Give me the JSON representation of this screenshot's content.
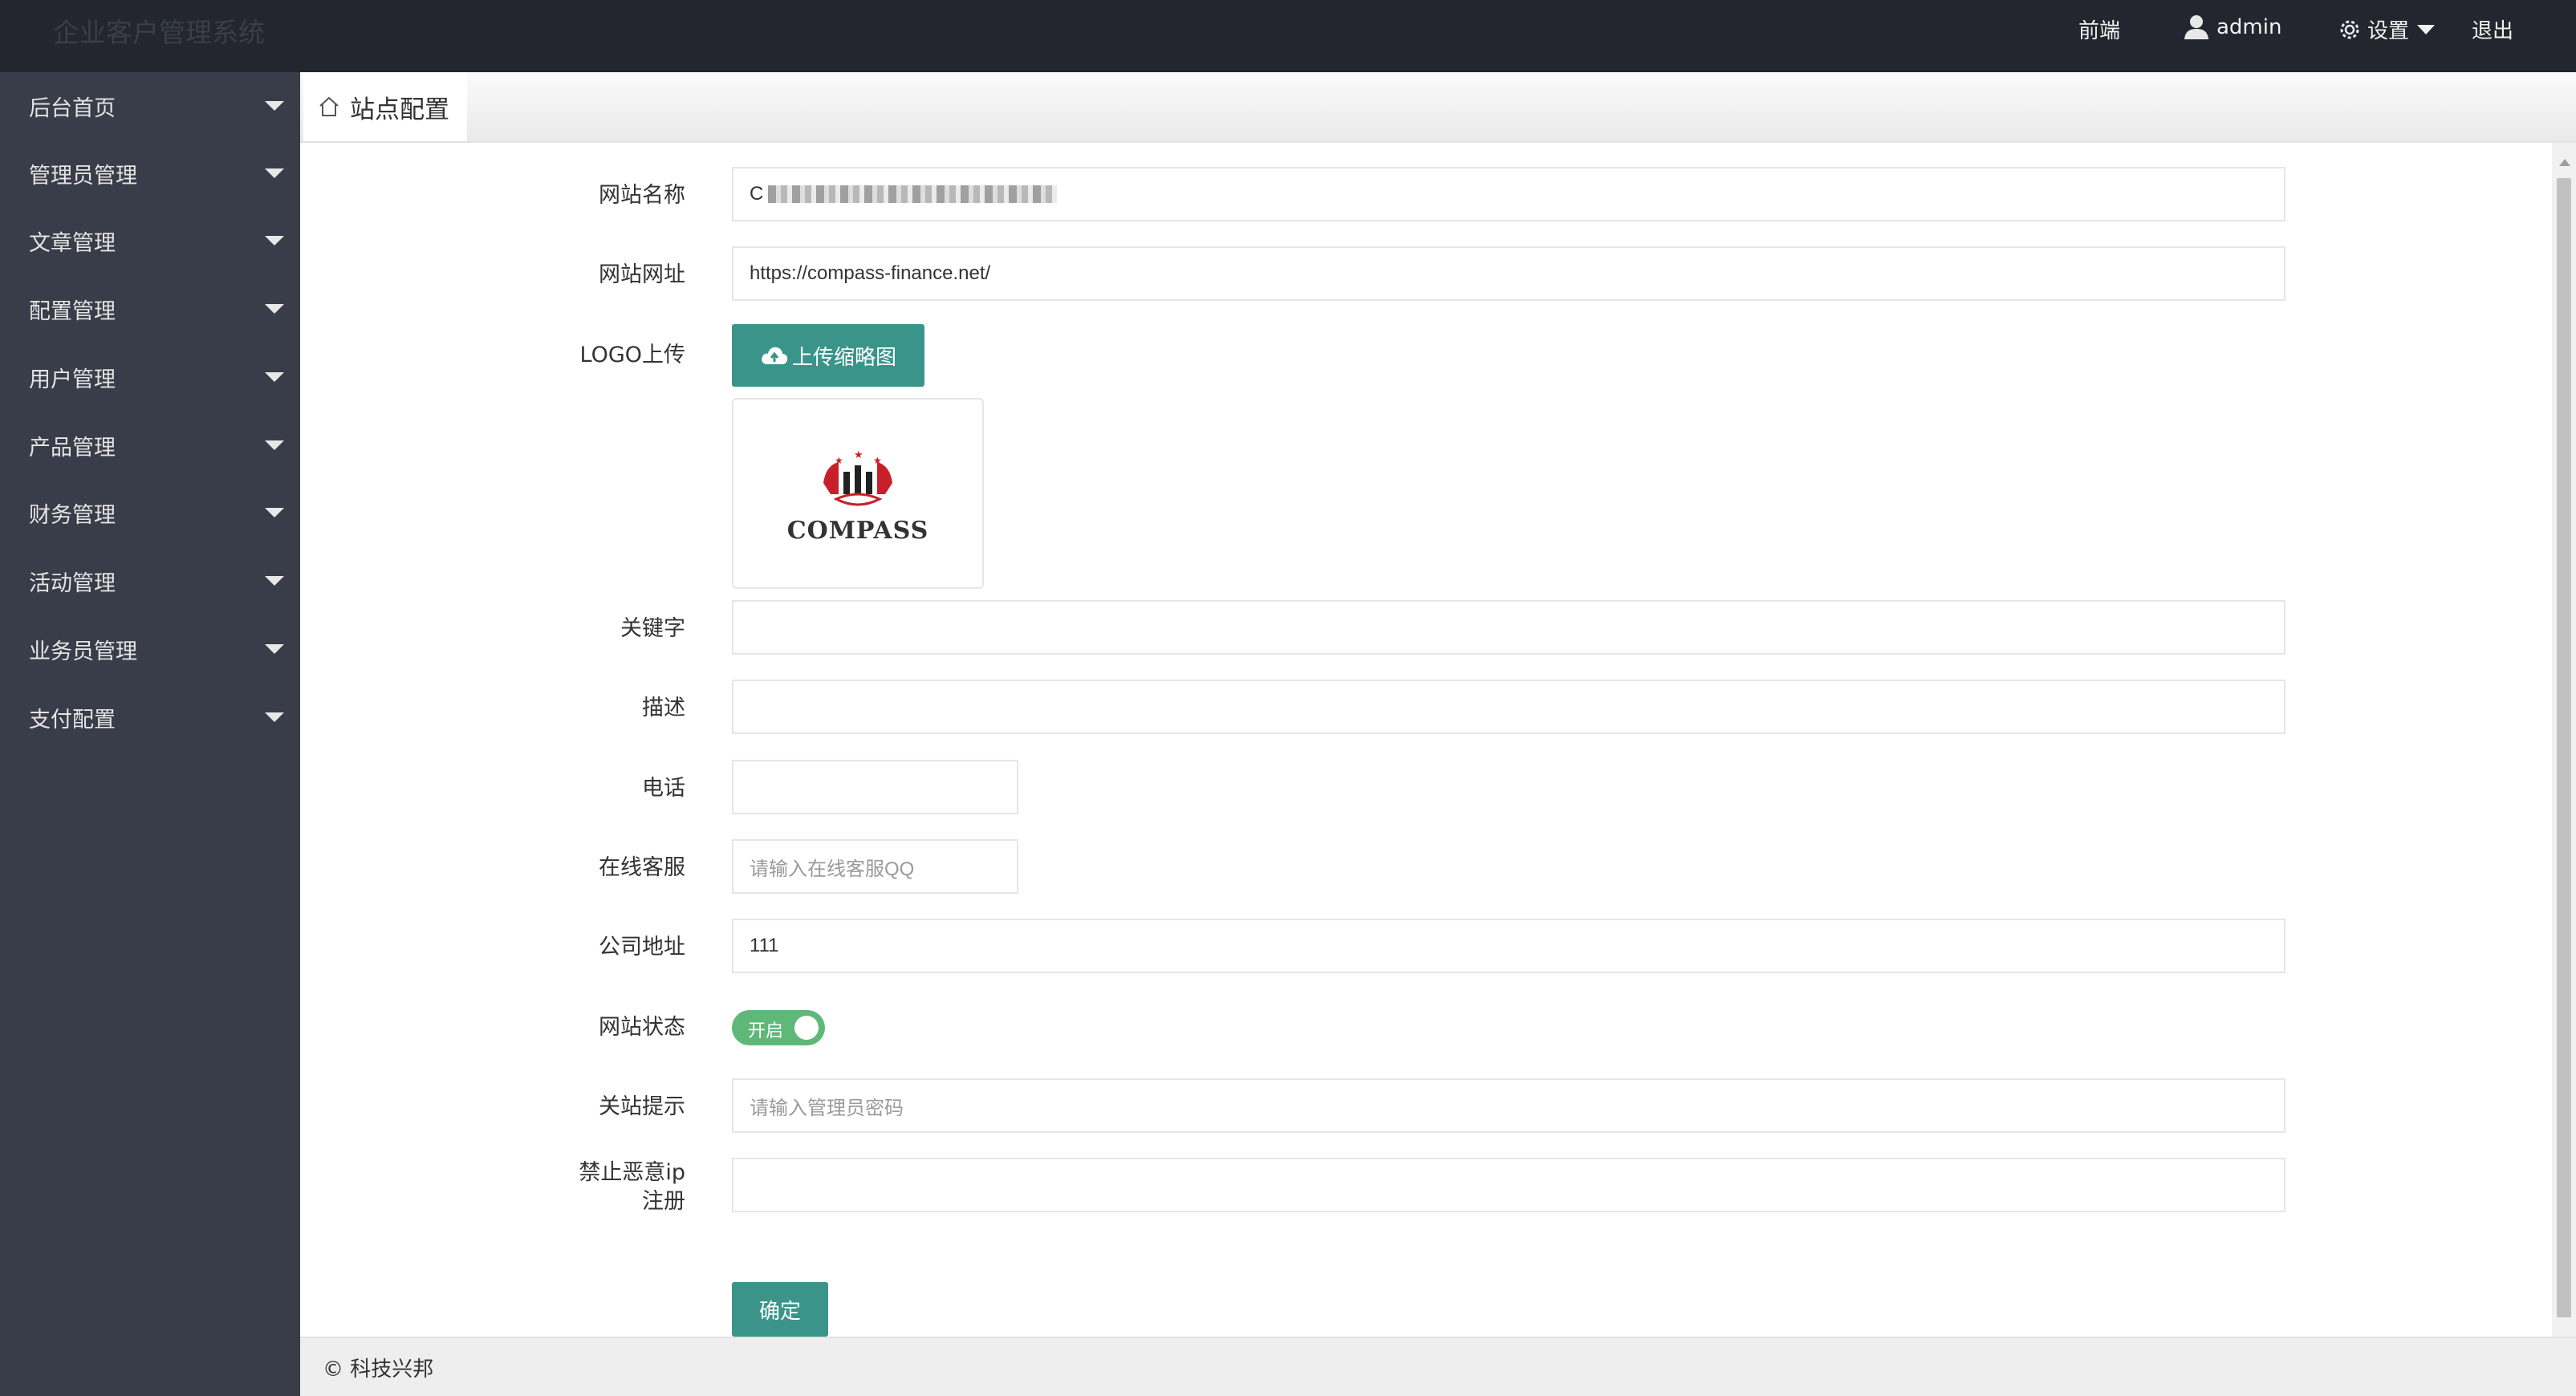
{
  "app": {
    "title": "企业客户管理系统"
  },
  "topnav": {
    "frontend": "前端",
    "user": "admin",
    "settings": "设置",
    "logout": "退出"
  },
  "sidebar": {
    "items": [
      {
        "label": "后台首页"
      },
      {
        "label": "管理员管理"
      },
      {
        "label": "文章管理"
      },
      {
        "label": "配置管理"
      },
      {
        "label": "用户管理"
      },
      {
        "label": "产品管理"
      },
      {
        "label": "财务管理"
      },
      {
        "label": "活动管理"
      },
      {
        "label": "业务员管理"
      },
      {
        "label": "支付配置"
      }
    ]
  },
  "tabs": [
    {
      "label": "站点配置",
      "icon": "home-icon"
    }
  ],
  "form": {
    "site_name": {
      "label": "网站名称",
      "value": "C"
    },
    "site_url": {
      "label": "网站网址",
      "value": "https://compass-finance.net/"
    },
    "logo": {
      "label": "LOGO上传",
      "button": "上传缩略图",
      "preview_text": "COMPASS",
      "icon": "cloud-upload-icon"
    },
    "keywords": {
      "label": "关键字",
      "value": ""
    },
    "description": {
      "label": "描述",
      "value": ""
    },
    "phone": {
      "label": "电话",
      "value": ""
    },
    "online_service": {
      "label": "在线客服",
      "placeholder": "请输入在线客服QQ"
    },
    "address": {
      "label": "公司地址",
      "value": "111"
    },
    "site_status": {
      "label": "网站状态",
      "toggle_text": "开启",
      "on": true
    },
    "close_notice": {
      "label": "关站提示",
      "placeholder": "请输入管理员密码"
    },
    "block_ip": {
      "label_line1": "禁止恶意ip",
      "label_line2": "注册",
      "value": ""
    },
    "submit": "确定"
  },
  "footer": {
    "text": "© 科技兴邦"
  },
  "colors": {
    "topbar": "#23262e",
    "sidebar": "#393d49",
    "accent": "#3a948a",
    "switch_on": "#5fb878"
  }
}
